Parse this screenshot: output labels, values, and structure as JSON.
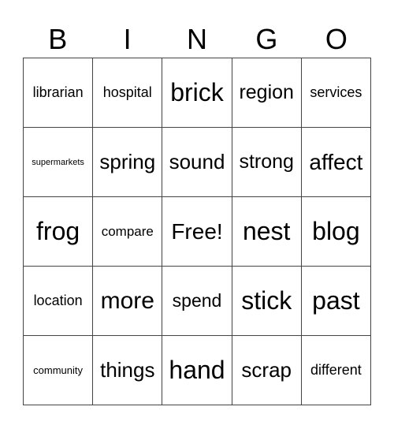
{
  "header": [
    "B",
    "I",
    "N",
    "G",
    "O"
  ],
  "cells": [
    {
      "text": "librarian",
      "size": 18
    },
    {
      "text": "hospital",
      "size": 18
    },
    {
      "text": "brick",
      "size": 32
    },
    {
      "text": "region",
      "size": 25
    },
    {
      "text": "services",
      "size": 18
    },
    {
      "text": "supermarkets",
      "size": 11
    },
    {
      "text": "spring",
      "size": 26
    },
    {
      "text": "sound",
      "size": 26
    },
    {
      "text": "strong",
      "size": 25
    },
    {
      "text": "affect",
      "size": 28
    },
    {
      "text": "frog",
      "size": 32
    },
    {
      "text": "compare",
      "size": 17
    },
    {
      "text": "Free!",
      "size": 28
    },
    {
      "text": "nest",
      "size": 32
    },
    {
      "text": "blog",
      "size": 32
    },
    {
      "text": "location",
      "size": 18
    },
    {
      "text": "more",
      "size": 30
    },
    {
      "text": "spend",
      "size": 23
    },
    {
      "text": "stick",
      "size": 32
    },
    {
      "text": "past",
      "size": 32
    },
    {
      "text": "community",
      "size": 13
    },
    {
      "text": "things",
      "size": 26
    },
    {
      "text": "hand",
      "size": 32
    },
    {
      "text": "scrap",
      "size": 26
    },
    {
      "text": "different",
      "size": 18
    }
  ]
}
